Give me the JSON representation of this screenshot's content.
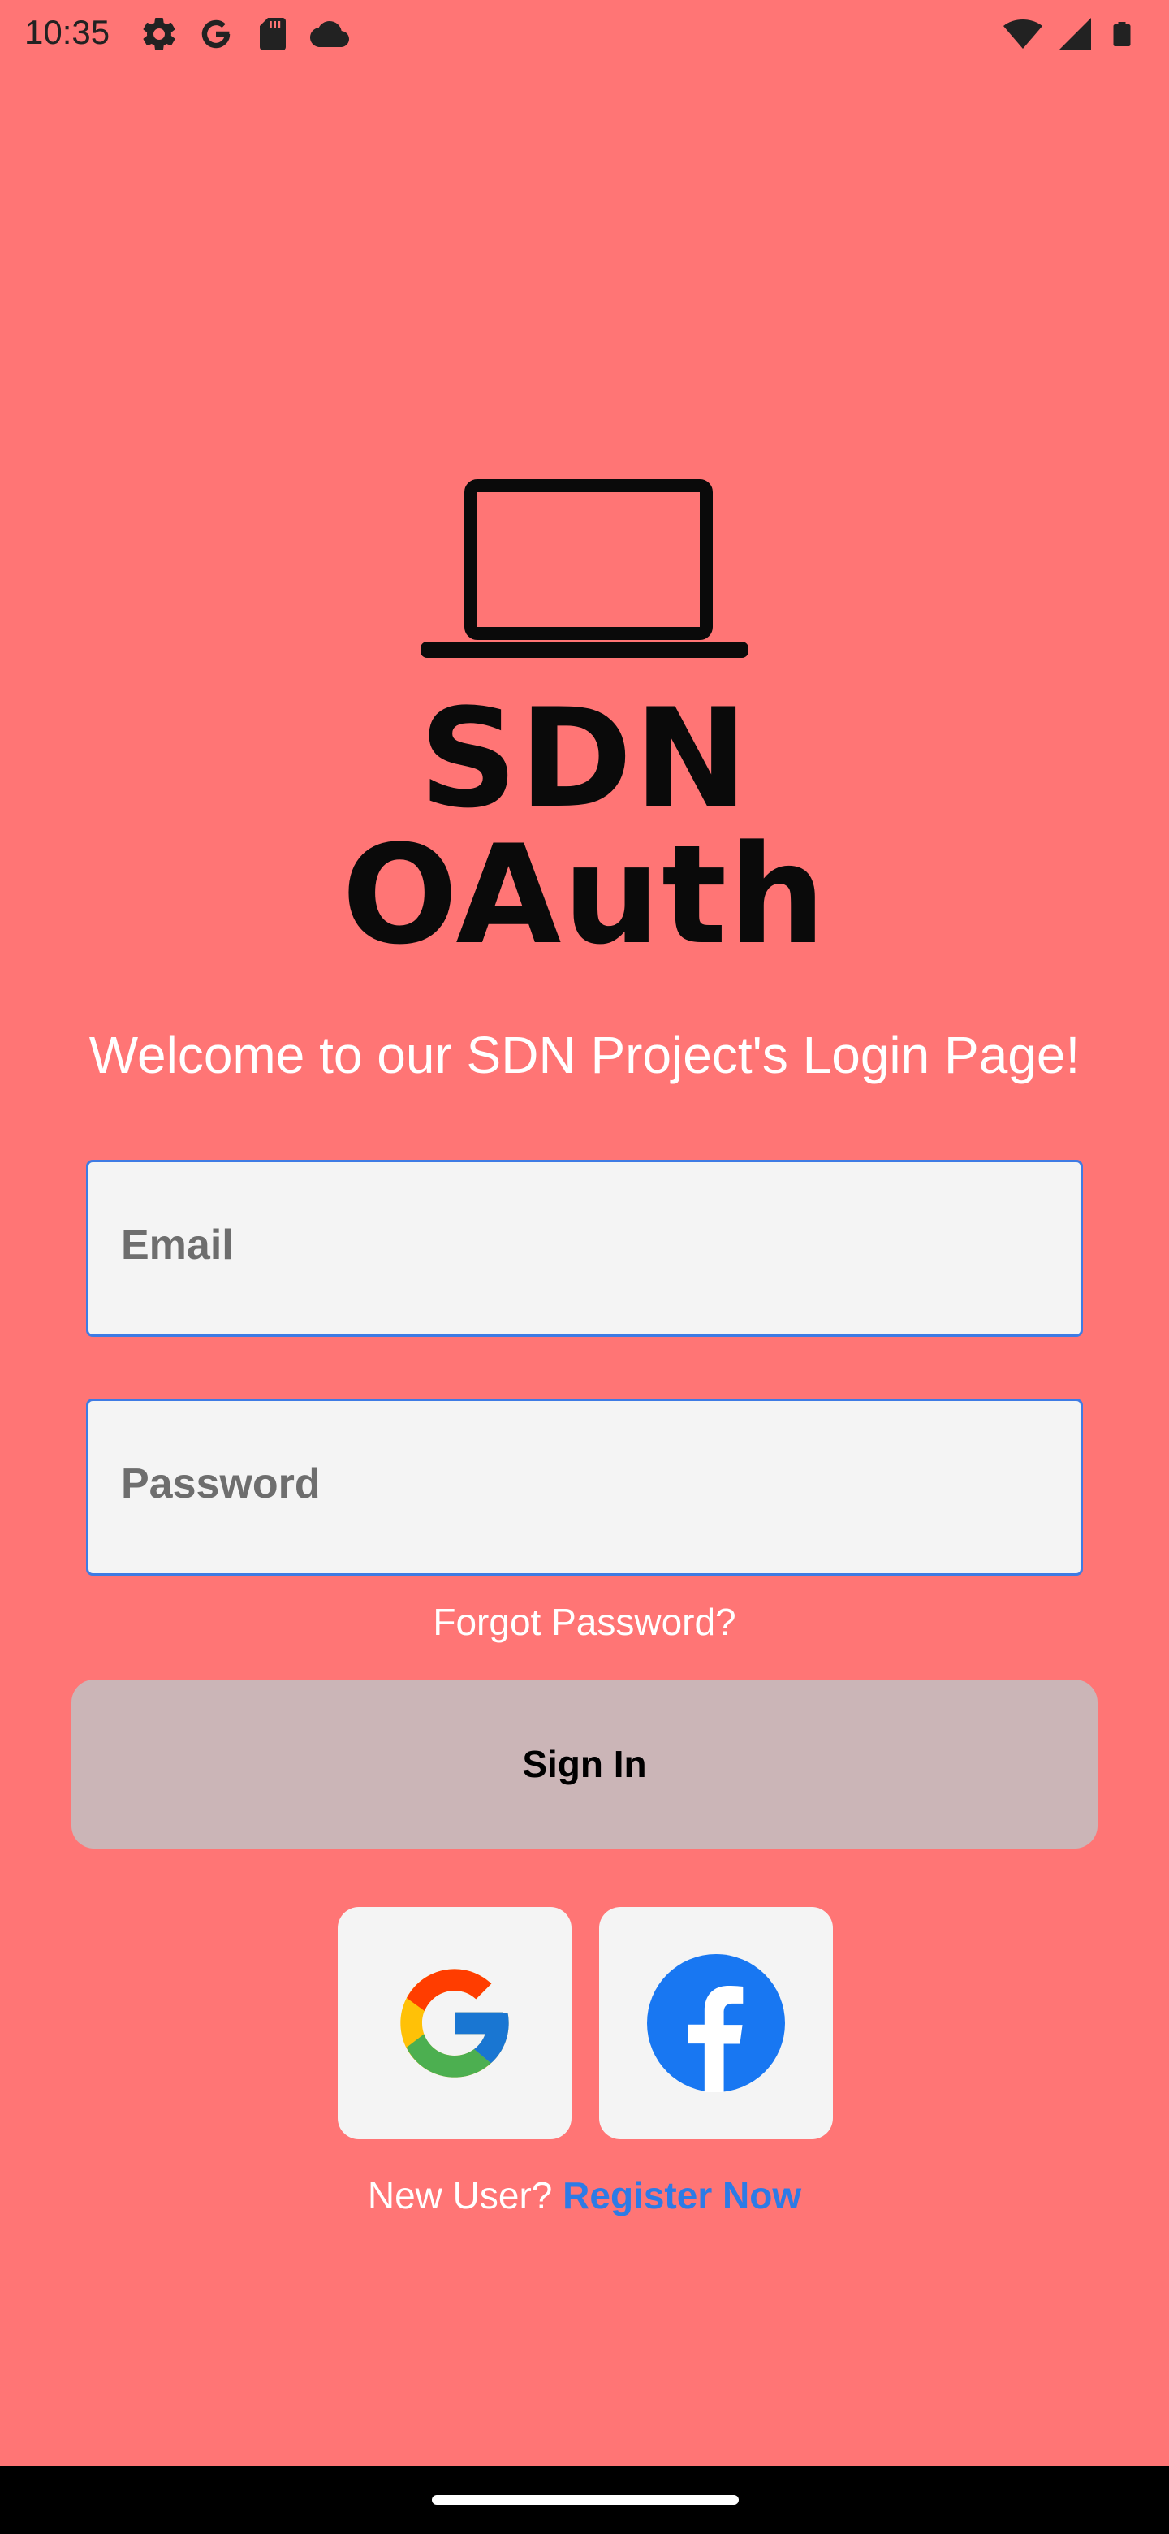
{
  "status_bar": {
    "time": "10:35",
    "left_icons": [
      "gear-icon",
      "google-g-icon",
      "sd-card-icon",
      "cloud-icon"
    ],
    "right_icons": [
      "wifi-icon",
      "signal-icon",
      "battery-icon"
    ]
  },
  "logo": {
    "icon": "laptop-icon",
    "text": "SDN OAuth"
  },
  "welcome_text": "Welcome to our SDN Project's Login Page!",
  "form": {
    "email_placeholder": "Email",
    "password_placeholder": "Password",
    "forgot_password": "Forgot Password?",
    "sign_in_label": "Sign In"
  },
  "social": {
    "google_icon": "google-logo-icon",
    "facebook_icon": "facebook-logo-icon"
  },
  "register": {
    "prompt": "New User?",
    "link": "Register Now"
  },
  "colors": {
    "background": "#FF7575",
    "field_border": "#3E7BE4",
    "sign_in_button": "#CBB5B7",
    "link": "#2D7BE6"
  }
}
